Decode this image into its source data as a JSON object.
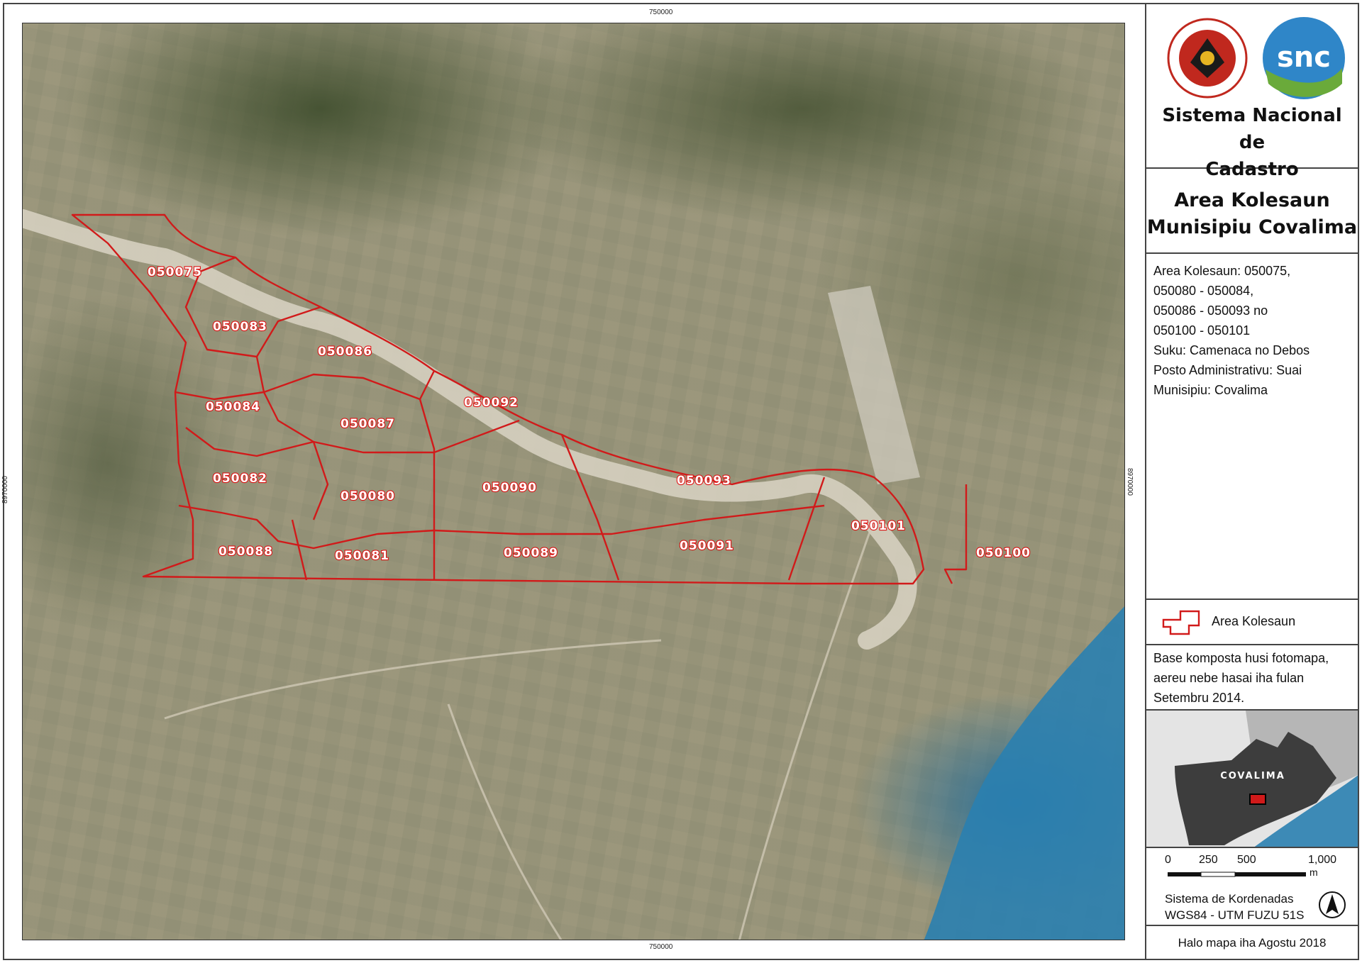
{
  "coordinates": {
    "top": "750000",
    "bottom": "750000",
    "left": "8970000",
    "right": "8970000"
  },
  "parcels": [
    "050075",
    "050083",
    "050086",
    "050084",
    "050087",
    "050092",
    "050082",
    "050080",
    "050090",
    "050093",
    "050101",
    "050088",
    "050081",
    "050089",
    "050091",
    "050100"
  ],
  "panel": {
    "org_name_line1": "Sistema Nacional de",
    "org_name_line2": "Cadastro",
    "logo_text": "snc",
    "map_title_line1": "Area Kolesaun",
    "map_title_line2": "Munisipiu Covalima",
    "info_lines": [
      "Area Kolesaun: 050075,",
      "050080 - 050084,",
      "050086 - 050093  no",
      "050100 - 050101",
      "Suku: Camenaca no Debos",
      "Posto Administrativu: Suai",
      "Munisipiu: Covalima"
    ],
    "legend_label": "Area Kolesaun",
    "base_note": "Base komposta husi fotomapa, aereu nebe hasai iha fulan Setembru 2014.",
    "inset_label": "COVALIMA",
    "scale_ticks": [
      "0",
      "250",
      "500",
      "1,000"
    ],
    "scale_unit": "m",
    "crs_line1": "Sistema de Kordenadas",
    "crs_line2": "WGS84 - UTM FUZU 51S",
    "map_date": "Halo mapa iha Agostu 2018"
  },
  "colors": {
    "boundary": "#d11a1a",
    "snc_blue": "#2f86c8",
    "snc_green": "#6aaa3a",
    "sea": "#2a7fb0"
  }
}
